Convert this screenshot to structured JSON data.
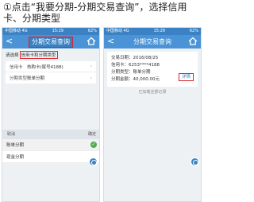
{
  "instruction": "①点击“我要分期-分期交易查询”，选择信用卡、分期类型",
  "phone1": {
    "status": {
      "carrier": "中国移动",
      "net": "4G",
      "time": "15:29",
      "battery": "62%"
    },
    "back": "<",
    "title": "分期交易查询",
    "prompt_prefix": "请选择",
    "prompt_highlight": "信用卡和分期类型",
    "rows": [
      {
        "label": "信用卡",
        "value": "热购卡(尾号4188)"
      },
      {
        "label": "分期类型",
        "value": "账单分期"
      }
    ],
    "picker": {
      "cancel": "取消",
      "confirm": "确定",
      "options": [
        {
          "label": "账单分期",
          "selected": true
        },
        {
          "label": "现金分期",
          "selected": false
        }
      ]
    }
  },
  "phone2": {
    "status": {
      "carrier": "中国移动",
      "net": "4G",
      "time": "15:29",
      "battery": "62%"
    },
    "back": "<",
    "title": "分期交易查询",
    "details": [
      {
        "label": "交易日期：",
        "value": "2016/08/25"
      },
      {
        "label": "信用卡：",
        "value": "6253****4188"
      },
      {
        "label": "分期类型：",
        "value": "账单分期"
      },
      {
        "label": "分期金额：",
        "value": "40,000.00元"
      }
    ],
    "detail_button": "详情",
    "footnote": "已加载全部记录"
  },
  "colors": {
    "accent": "#4a93d6",
    "highlight": "#d9262c",
    "check": "#4cae4c"
  },
  "icons": [
    "back-chevron-icon",
    "home-icon",
    "chevron-right-icon",
    "check-icon",
    "assistant-bubble-icon"
  ]
}
